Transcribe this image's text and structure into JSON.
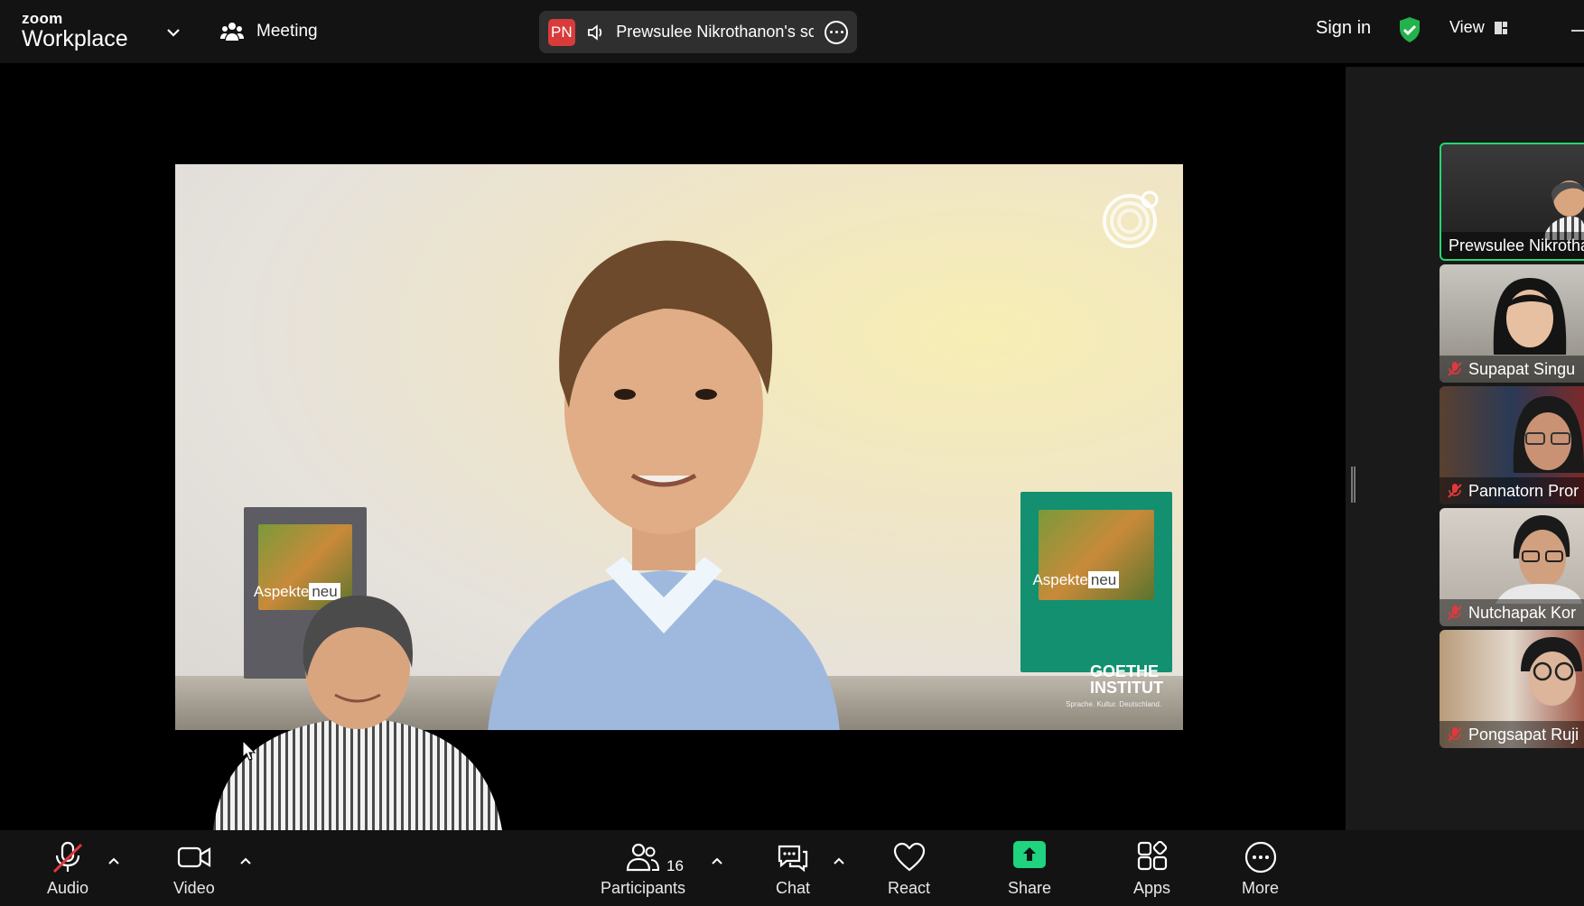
{
  "app": {
    "brand_small": "zoom",
    "brand_large": "Workplace"
  },
  "topbar": {
    "meeting_label": "Meeting",
    "share_indicator": {
      "badge": "PN",
      "text": "Prewsulee Nikrothanon's scr"
    },
    "sign_in": "Sign in",
    "view_label": "View"
  },
  "main_video": {
    "book_left_label_a": "Aspekte",
    "book_left_label_b": "neu",
    "book_right_label_a": "Aspekte",
    "book_right_label_b": "neu",
    "logo_text_line1": "GOETHE",
    "logo_text_line2": "INSTITUT",
    "logo_subtext": "Sprache. Kultur. Deutschland."
  },
  "participants_gallery": [
    {
      "name": "Prewsulee Nikrothanon",
      "muted": false,
      "active_speaker": true
    },
    {
      "name": "Supapat Singu",
      "muted": true,
      "active_speaker": false
    },
    {
      "name": "Pannatorn Pror",
      "muted": true,
      "active_speaker": false
    },
    {
      "name": "Nutchapak Kor",
      "muted": true,
      "active_speaker": false
    },
    {
      "name": "Pongsapat Ruji",
      "muted": true,
      "active_speaker": false
    }
  ],
  "toolbar": {
    "audio": "Audio",
    "video": "Video",
    "participants": "Participants",
    "participants_count": "16",
    "chat": "Chat",
    "react": "React",
    "share": "Share",
    "apps": "Apps",
    "more": "More"
  },
  "colors": {
    "active_speaker_border": "#23d96f",
    "share_green": "#1fd37f",
    "badge_red": "#d93b3b",
    "muted_red": "#e0383e",
    "bar_bg": "#131313"
  }
}
